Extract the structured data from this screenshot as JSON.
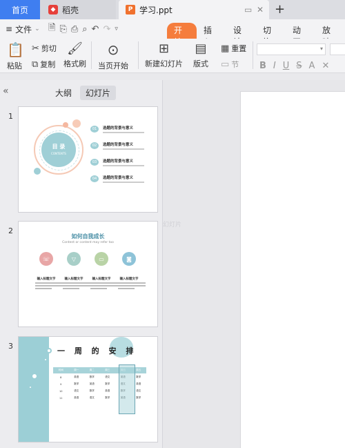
{
  "tabs": {
    "home": "首页",
    "daoke": "稻壳",
    "document": "学习.ppt",
    "add": "+"
  },
  "menubar": {
    "file": "文件",
    "items": [
      "开始",
      "插入",
      "设计",
      "切换",
      "动画",
      "放映"
    ]
  },
  "ribbon": {
    "paste": "粘贴",
    "cut": "剪切",
    "copy": "复制",
    "format_painter": "格式刷",
    "play_from_current": "当页开始",
    "new_slide": "新建幻灯片",
    "layout": "版式",
    "reset": "重置",
    "section": "节"
  },
  "left_pane": {
    "outline_tab": "大纲",
    "slides_tab": "幻灯片",
    "slide_numbers": [
      "1",
      "2",
      "3"
    ]
  },
  "slide1": {
    "title": "目 录",
    "subtitle": "CONTENTS",
    "items": [
      {
        "num": "01",
        "text": "选题的背景与意义"
      },
      {
        "num": "02",
        "text": "选题的背景与意义"
      },
      {
        "num": "03",
        "text": "选题的背景与意义"
      },
      {
        "num": "04",
        "text": "选题的背景与意义"
      }
    ]
  },
  "slide2": {
    "title": "如何自我成长",
    "subtitle": "Content or content may refer too",
    "labels": [
      "输入标题文字",
      "输入标题文字",
      "输入标题文字",
      "输入标题文字"
    ],
    "circle_colors": [
      "#e8a6a6",
      "#a8cfc8",
      "#b9d3a6",
      "#8ec3d8"
    ]
  },
  "slide3": {
    "title": "一 周 的 安 排",
    "head": [
      "时间",
      "周一",
      "周二",
      "周三",
      "周四",
      "周五"
    ],
    "rows": [
      [
        "8",
        "英语",
        "数学",
        "语文",
        "英语",
        "数学"
      ],
      [
        "9",
        "数学",
        "英语",
        "数学",
        "语文",
        "英语"
      ],
      [
        "10",
        "语文",
        "数学",
        "英语",
        "数学",
        "语文"
      ],
      [
        "11",
        "英语",
        "语文",
        "数学",
        "英语",
        "数学"
      ]
    ]
  },
  "canvas": {
    "watermark": "幻灯片"
  }
}
